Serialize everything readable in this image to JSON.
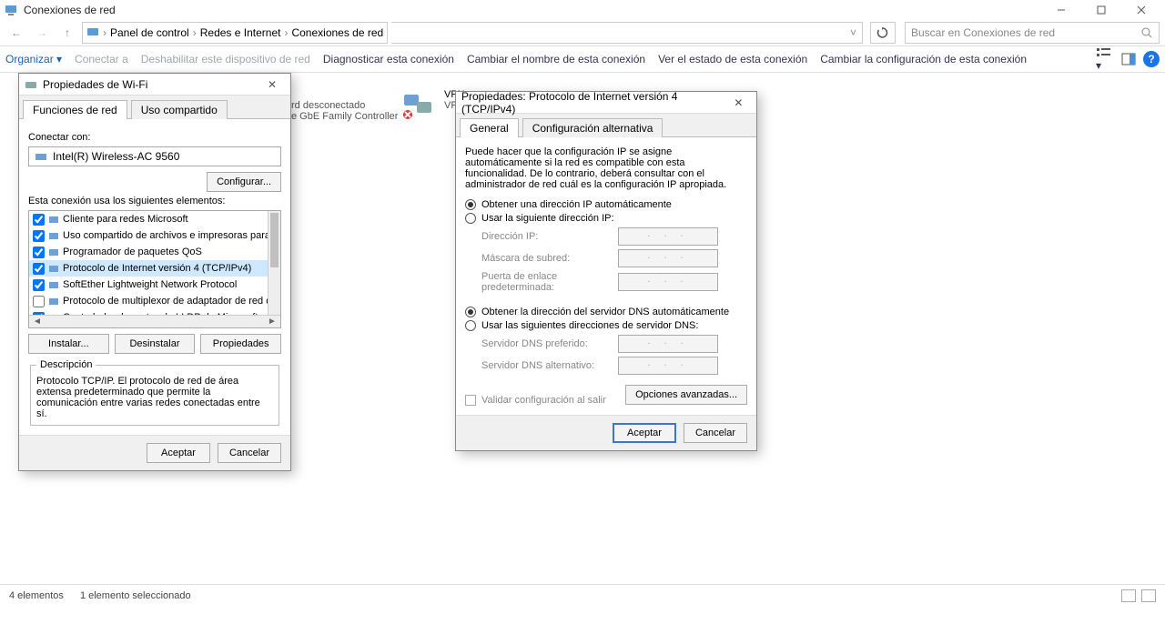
{
  "window": {
    "title": "Conexiones de red"
  },
  "breadcrumb": {
    "cp_label": "Panel de control",
    "net_label": "Redes e Internet",
    "conn_label": "Conexiones de red"
  },
  "search": {
    "placeholder": "Buscar en Conexiones de red"
  },
  "cmdbar": {
    "organize": "Organizar",
    "connect": "Conectar a",
    "disable": "Deshabilitar este dispositivo de red",
    "diagnose": "Diagnosticar esta conexión",
    "rename": "Cambiar el nombre de esta conexión",
    "viewstatus": "Ver el estado de esta conexión",
    "changeconf": "Cambiar la configuración de esta conexión"
  },
  "bg_items": {
    "eth_sub1": "rd desconectado",
    "eth_sub2": "e GbE Family Controller",
    "vpn_title": "VPN",
    "vpn_sub": "VPN"
  },
  "wifi": {
    "title": "Propiedades de Wi-Fi",
    "tab_func": "Funciones de red",
    "tab_share": "Uso compartido",
    "connect_with": "Conectar con:",
    "adapter": "Intel(R) Wireless-AC 9560",
    "configure": "Configurar...",
    "elements_label": "Esta conexión usa los siguientes elementos:",
    "items": [
      {
        "checked": true,
        "label": "Cliente para redes Microsoft"
      },
      {
        "checked": true,
        "label": "Uso compartido de archivos e impresoras para redes M"
      },
      {
        "checked": true,
        "label": "Programador de paquetes QoS"
      },
      {
        "checked": true,
        "label": "Protocolo de Internet versión 4 (TCP/IPv4)",
        "selected": true
      },
      {
        "checked": true,
        "label": "SoftEther Lightweight Network Protocol"
      },
      {
        "checked": false,
        "label": "Protocolo de multiplexor de adaptador de red de Micros"
      },
      {
        "checked": true,
        "label": "Controlador de protocolo LLDP de Microsoft"
      }
    ],
    "install": "Instalar...",
    "uninstall": "Desinstalar",
    "properties": "Propiedades",
    "desc_title": "Descripción",
    "desc_text": "Protocolo TCP/IP. El protocolo de red de área extensa predeterminado que permite la comunicación entre varias redes conectadas entre sí.",
    "accept": "Aceptar",
    "cancel": "Cancelar"
  },
  "ipv4": {
    "title": "Propiedades: Protocolo de Internet versión 4 (TCP/IPv4)",
    "tab_general": "General",
    "tab_alt": "Configuración alternativa",
    "info": "Puede hacer que la configuración IP se asigne automáticamente si la red es compatible con esta funcionalidad. De lo contrario, deberá consultar con el administrador de red cuál es la configuración IP apropiada.",
    "r_auto_ip": "Obtener una dirección IP automáticamente",
    "r_manual_ip": "Usar la siguiente dirección IP:",
    "f_ip": "Dirección IP:",
    "f_mask": "Máscara de subred:",
    "f_gw": "Puerta de enlace predeterminada:",
    "r_auto_dns": "Obtener la dirección del servidor DNS automáticamente",
    "r_manual_dns": "Usar las siguientes direcciones de servidor DNS:",
    "f_dns1": "Servidor DNS preferido:",
    "f_dns2": "Servidor DNS alternativo:",
    "validate": "Validar configuración al salir",
    "advanced": "Opciones avanzadas...",
    "accept": "Aceptar",
    "cancel": "Cancelar",
    "ip_placeholder": ".   .   ."
  },
  "status": {
    "left1": "4 elementos",
    "left2": "1 elemento seleccionado"
  }
}
